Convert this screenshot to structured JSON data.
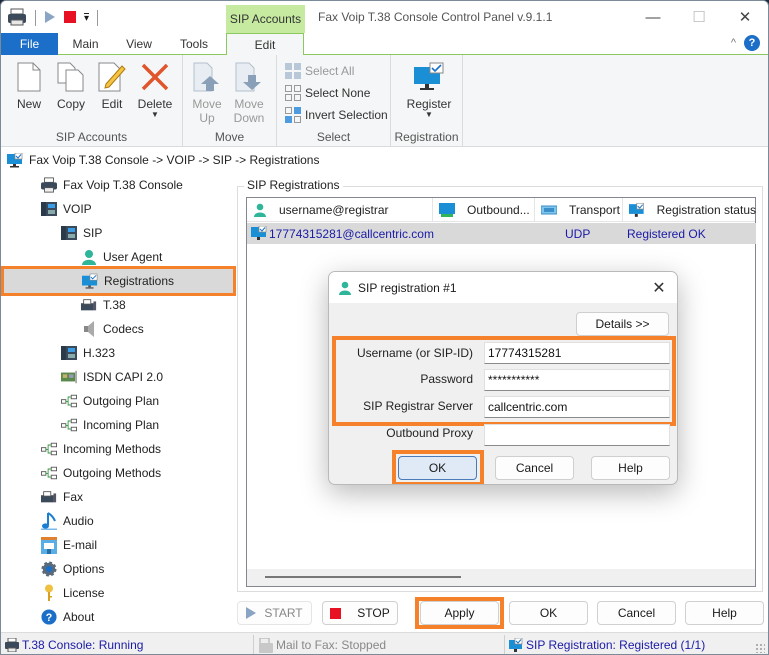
{
  "window": {
    "title": "Fax Voip T.38 Console Control Panel v.9.1.1",
    "contextual_tab_group": "SIP Accounts",
    "controls": {
      "minimize": "—",
      "maximize": "☐",
      "close": "✕"
    }
  },
  "quick_access": {
    "customize": "▾"
  },
  "ribbon": {
    "tabs": [
      {
        "label": "File",
        "active": false
      },
      {
        "label": "Main",
        "active": false
      },
      {
        "label": "View",
        "active": false
      },
      {
        "label": "Tools",
        "active": false
      },
      {
        "label": "Edit",
        "active": true
      }
    ],
    "collapse_glyph": "^",
    "help_glyph": "?",
    "groups": {
      "sip_accounts": {
        "label": "SIP Accounts",
        "buttons": {
          "new": "New",
          "copy": "Copy",
          "edit": "Edit",
          "delete": "Delete"
        }
      },
      "move": {
        "label": "Move",
        "buttons": {
          "up_1": "Move",
          "up_2": "Up",
          "down_1": "Move",
          "down_2": "Down"
        }
      },
      "select": {
        "label": "Select",
        "buttons": {
          "select_all": "Select All",
          "select_none": "Select None",
          "invert": "Invert Selection"
        }
      },
      "registration": {
        "label": "Registration",
        "buttons": {
          "register": "Register"
        }
      }
    }
  },
  "breadcrumb": "Fax Voip T.38 Console -> VOIP -> SIP -> Registrations",
  "tree": [
    {
      "label": "Fax Voip T.38 Console",
      "icon": "fax-machine-icon"
    },
    {
      "label": "VOIP",
      "icon": "ip-phone-icon"
    },
    {
      "label": "SIP",
      "icon": "ip-phone-icon"
    },
    {
      "label": "User Agent",
      "icon": "user-icon"
    },
    {
      "label": "Registrations",
      "icon": "monitor-check-icon",
      "selected": true
    },
    {
      "label": "T.38",
      "icon": "fax-icon"
    },
    {
      "label": "Codecs",
      "icon": "speaker-icon"
    },
    {
      "label": "H.323",
      "icon": "ip-phone-icon"
    },
    {
      "label": "ISDN CAPI 2.0",
      "icon": "isdn-card-icon"
    },
    {
      "label": "Outgoing Plan",
      "icon": "routing-plan-icon"
    },
    {
      "label": "Incoming Plan",
      "icon": "routing-plan-icon"
    },
    {
      "label": "Incoming Methods",
      "icon": "routing-plan-icon"
    },
    {
      "label": "Outgoing Methods",
      "icon": "routing-plan-icon"
    },
    {
      "label": "Fax",
      "icon": "fax-icon"
    },
    {
      "label": "Audio",
      "icon": "music-note-icon"
    },
    {
      "label": "E-mail",
      "icon": "mailbox-icon"
    },
    {
      "label": "Options",
      "icon": "gear-icon"
    },
    {
      "label": "License",
      "icon": "key-icon"
    },
    {
      "label": "About",
      "icon": "help-icon"
    }
  ],
  "registrations": {
    "title": "SIP Registrations",
    "columns": [
      "username@registrar",
      "Outbound...",
      "Transport",
      "Registration status"
    ],
    "rows": [
      {
        "account": "17774315281@callcentric.com",
        "outbound": "",
        "transport": "UDP",
        "status": "Registered OK"
      }
    ]
  },
  "dialog": {
    "title": "SIP registration #1",
    "details_button": "Details >>",
    "fields": {
      "username": {
        "label": "Username (or SIP-ID)",
        "value": "17774315281"
      },
      "password": {
        "label": "Password",
        "value": "***********"
      },
      "registrar": {
        "label": "SIP Registrar Server",
        "value": "callcentric.com"
      },
      "proxy": {
        "label": "Outbound Proxy",
        "value": ""
      }
    },
    "buttons": {
      "ok": "OK",
      "cancel": "Cancel",
      "help": "Help"
    }
  },
  "bottom_buttons": {
    "start": "START",
    "stop": "STOP",
    "apply": "Apply",
    "ok": "OK",
    "cancel": "Cancel",
    "help": "Help"
  },
  "status_bar": {
    "console": "T.38 Console: Running",
    "mail_to_fax": "Mail to Fax: Stopped",
    "sip_registration": "SIP Registration: Registered (1/1)"
  },
  "colors": {
    "accent_blue": "#1c6fc8",
    "contextual_green": "#c6eba0",
    "highlight_orange": "#f5822a",
    "link_text": "#1a1aa8",
    "stop_red": "#e81123"
  }
}
